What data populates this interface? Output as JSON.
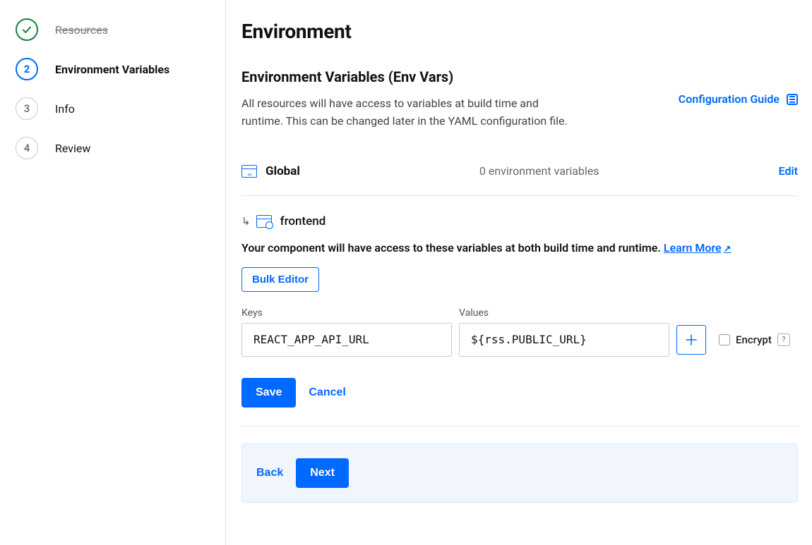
{
  "sidebar": {
    "steps": [
      {
        "label": "Resources",
        "state": "complete"
      },
      {
        "label": "Environment Variables",
        "number": "2",
        "state": "current"
      },
      {
        "label": "Info",
        "number": "3",
        "state": "pending"
      },
      {
        "label": "Review",
        "number": "4",
        "state": "pending"
      }
    ]
  },
  "page": {
    "title": "Environment",
    "subtitle": "Environment Variables (Env Vars)",
    "description": "All resources will have access to variables at build time and runtime. This can be changed later in the YAML configuration file.",
    "config_guide_label": "Configuration Guide"
  },
  "global_scope": {
    "label": "Global",
    "count_text": "0 environment variables",
    "edit_label": "Edit"
  },
  "component": {
    "name": "frontend",
    "description_prefix": "Your component will have access to these variables at both build time and runtime. ",
    "learn_more_label": "Learn More",
    "bulk_editor_label": "Bulk Editor"
  },
  "env_form": {
    "keys_label": "Keys",
    "values_label": "Values",
    "key_input": "REACT_APP_API_URL",
    "value_input": "${rss.PUBLIC_URL}",
    "encrypt_label": "Encrypt",
    "save_label": "Save",
    "cancel_label": "Cancel"
  },
  "footer": {
    "back_label": "Back",
    "next_label": "Next"
  }
}
